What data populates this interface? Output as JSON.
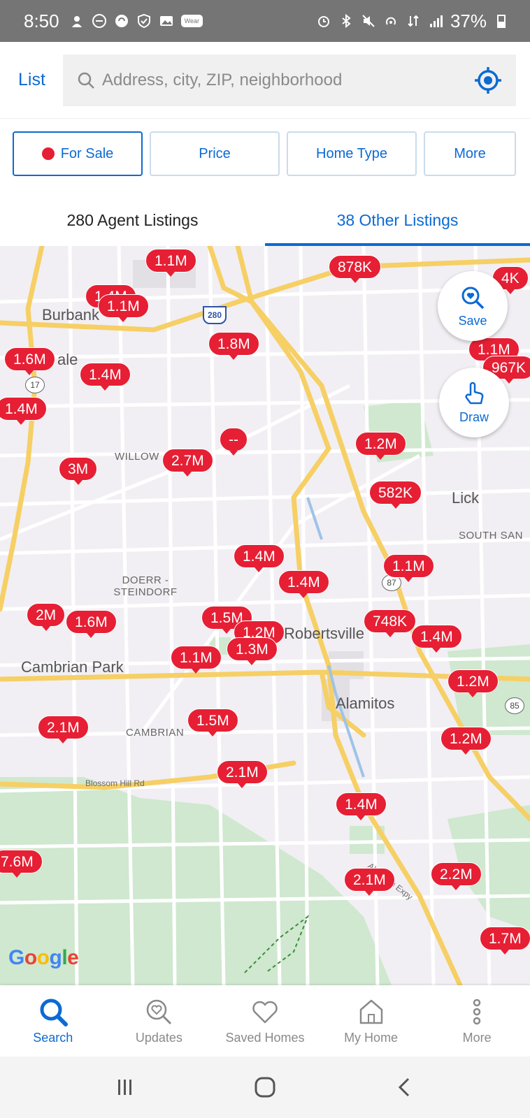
{
  "status_bar": {
    "time": "8:50",
    "wear_badge": "Wear",
    "battery": "37%"
  },
  "header": {
    "list_label": "List",
    "search_placeholder": "Address, city, ZIP, neighborhood"
  },
  "filters": [
    {
      "label": "For Sale",
      "active": true
    },
    {
      "label": "Price",
      "active": false
    },
    {
      "label": "Home Type",
      "active": false
    },
    {
      "label": "More",
      "active": false
    }
  ],
  "tabs": [
    {
      "label": "280 Agent Listings",
      "active": false
    },
    {
      "label": "38 Other Listings",
      "active": true
    }
  ],
  "map": {
    "place_labels": [
      "Burbank",
      "ale",
      "WILLOW",
      "Lick",
      "SOUTH SAN",
      "DOERR - STEINDORF",
      "Robertsville",
      "Cambrian Park",
      "Alamitos",
      "CAMBRIAN"
    ],
    "road_labels": [
      "Blossom Hill Rd",
      "Almaden Expy"
    ],
    "shields": [
      "17",
      "87",
      "85",
      "280"
    ],
    "price_pins": [
      "1.1M",
      "878K",
      "4K",
      "1.4M",
      "1.1M",
      "1.8M",
      "1.1M",
      "967K",
      "1.6M",
      "1.4M",
      "1.4M",
      "--",
      "1.2M",
      "3M",
      "2.7M",
      "582K",
      "1.4M",
      "1.1M",
      "1.4M",
      "2M",
      "1.6M",
      "1.5M",
      "748K",
      "1.2M",
      "1.4M",
      "1.3M",
      "1.1M",
      "1.2M",
      "2.1M",
      "1.5M",
      "1.2M",
      "2.1M",
      "1.4M",
      "7.6M",
      "2.1M",
      "2.2M",
      "1.7M"
    ],
    "save_label": "Save",
    "draw_label": "Draw",
    "google_logo": "Google"
  },
  "bottom_nav": [
    {
      "label": "Search",
      "icon": "search-icon",
      "active": true
    },
    {
      "label": "Updates",
      "icon": "updates-icon",
      "active": false
    },
    {
      "label": "Saved Homes",
      "icon": "heart-icon",
      "active": false
    },
    {
      "label": "My Home",
      "icon": "house-icon",
      "active": false
    },
    {
      "label": "More",
      "icon": "more-icon",
      "active": false
    }
  ],
  "colors": {
    "accent": "#0c6ad3",
    "pin": "#e61f34",
    "map_bg": "#f1eff3",
    "highway": "#f6cf65",
    "park": "#cfe8cf"
  }
}
